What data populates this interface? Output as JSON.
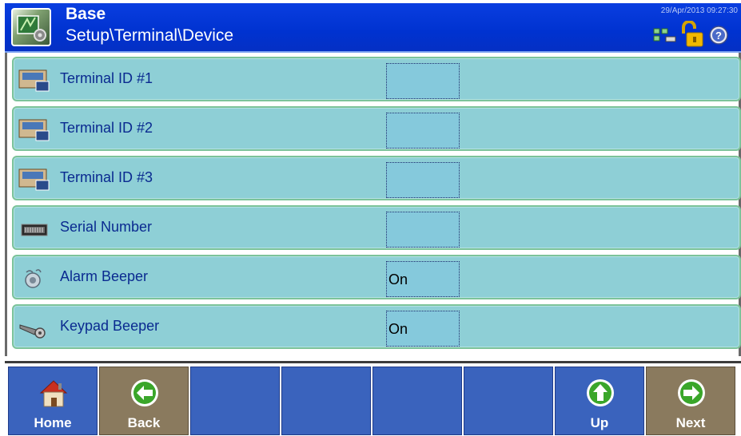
{
  "header": {
    "title": "Base",
    "path": "Setup\\Terminal\\Device",
    "datetime": "29/Apr/2013 09:27:30",
    "icons": [
      "network-icon",
      "padlock-open-icon",
      "help-icon"
    ]
  },
  "rows": [
    {
      "label": "Terminal ID #1",
      "value": "",
      "icon": "terminal-icon"
    },
    {
      "label": "Terminal ID #2",
      "value": "",
      "icon": "terminal-icon"
    },
    {
      "label": "Terminal ID #3",
      "value": "",
      "icon": "terminal-icon"
    },
    {
      "label": "Serial Number",
      "value": "",
      "icon": "serial-number-icon"
    },
    {
      "label": "Alarm Beeper",
      "value": "On",
      "icon": "alarm-beeper-icon"
    },
    {
      "label": "Keypad Beeper",
      "value": "On",
      "icon": "keypad-beeper-icon"
    }
  ],
  "softkeys": [
    {
      "label": "Home",
      "icon": "home-icon"
    },
    {
      "label": "Back",
      "icon": "back-arrow-icon"
    },
    {
      "label": "",
      "icon": ""
    },
    {
      "label": "",
      "icon": ""
    },
    {
      "label": "",
      "icon": ""
    },
    {
      "label": "",
      "icon": ""
    },
    {
      "label": "Up",
      "icon": "up-arrow-icon"
    },
    {
      "label": "Next",
      "icon": "next-arrow-icon"
    }
  ],
  "colors": {
    "header": "#0032d0",
    "row": "#8ecfd6",
    "softkey_blue": "#3a63bd",
    "softkey_brown": "#8a7a5e"
  }
}
